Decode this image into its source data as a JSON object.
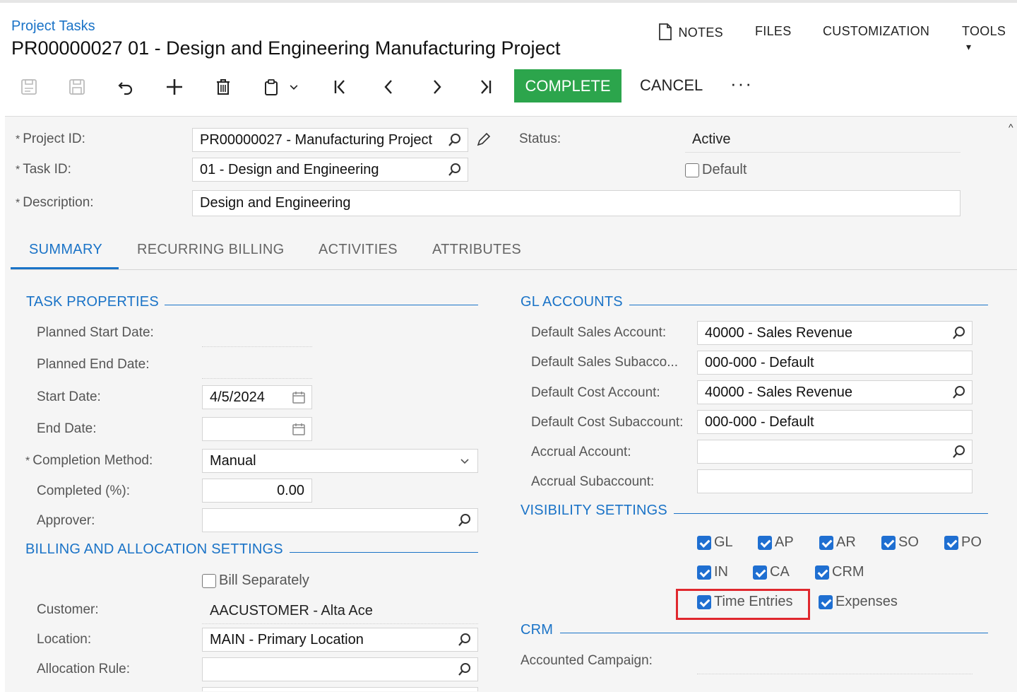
{
  "header": {
    "breadcrumb": "Project Tasks",
    "title": "PR00000027 01 - Design and Engineering Manufacturing Project",
    "menu": {
      "notes": "NOTES",
      "files": "FILES",
      "customization": "CUSTOMIZATION",
      "tools": "TOOLS"
    }
  },
  "toolbar": {
    "icons": [
      "save-close-icon",
      "save-icon",
      "undo-icon",
      "add-icon",
      "delete-icon",
      "copy-paste-icon",
      "chevron-down-icon",
      "first-record-icon",
      "previous-record-icon",
      "next-record-icon",
      "last-record-icon"
    ],
    "complete_label": "COMPLETE",
    "cancel_label": "CANCEL",
    "more_label": "···",
    "complete_color": "#2ca54c"
  },
  "form": {
    "project_id_label": "Project ID:",
    "project_id_value": "PR00000027 - Manufacturing Project",
    "task_id_label": "Task ID:",
    "task_id_value": "01 - Design and Engineering",
    "description_label": "Description:",
    "description_value": "Design and Engineering",
    "status_label": "Status:",
    "status_value": "Active",
    "default_label": "Default",
    "default_checked": false,
    "required_marker": "*"
  },
  "tabs": [
    {
      "label": "SUMMARY",
      "active": true
    },
    {
      "label": "RECURRING BILLING",
      "active": false
    },
    {
      "label": "ACTIVITIES",
      "active": false
    },
    {
      "label": "ATTRIBUTES",
      "active": false
    }
  ],
  "task_properties": {
    "heading": "TASK PROPERTIES",
    "planned_start_label": "Planned Start Date:",
    "planned_end_label": "Planned End Date:",
    "start_date_label": "Start Date:",
    "start_date_value": "4/5/2024",
    "end_date_label": "End Date:",
    "end_date_value": "",
    "completion_method_label": "Completion Method:",
    "completion_method_value": "Manual",
    "completed_pct_label": "Completed (%):",
    "completed_pct_value": "0.00",
    "approver_label": "Approver:",
    "approver_value": ""
  },
  "billing": {
    "heading": "BILLING AND ALLOCATION SETTINGS",
    "bill_separately_label": "Bill Separately",
    "bill_separately_checked": false,
    "customer_label": "Customer:",
    "customer_value": "AACUSTOMER - Alta Ace",
    "location_label": "Location:",
    "location_value": "MAIN - Primary Location",
    "allocation_rule_label": "Allocation Rule:",
    "allocation_rule_value": ""
  },
  "gl_accounts": {
    "heading": "GL ACCOUNTS",
    "sales_account_label": "Default Sales Account:",
    "sales_account_value": "40000 - Sales Revenue",
    "sales_sub_label": "Default Sales Subacco...",
    "sales_sub_value": "000-000 - Default",
    "cost_account_label": "Default Cost Account:",
    "cost_account_value": "40000 - Sales Revenue",
    "cost_sub_label": "Default Cost Subaccount:",
    "cost_sub_value": "000-000 - Default",
    "accrual_account_label": "Accrual Account:",
    "accrual_account_value": "",
    "accrual_sub_label": "Accrual Subaccount:",
    "accrual_sub_value": ""
  },
  "visibility": {
    "heading": "VISIBILITY SETTINGS",
    "items": [
      {
        "label": "GL",
        "checked": true
      },
      {
        "label": "AP",
        "checked": true
      },
      {
        "label": "AR",
        "checked": true
      },
      {
        "label": "SO",
        "checked": true
      },
      {
        "label": "PO",
        "checked": true
      },
      {
        "label": "IN",
        "checked": true
      },
      {
        "label": "CA",
        "checked": true
      },
      {
        "label": "CRM",
        "checked": true
      },
      {
        "label": "Time Entries",
        "checked": true
      },
      {
        "label": "Expenses",
        "checked": true
      }
    ],
    "highlight_color": "#e0282e"
  },
  "crm": {
    "heading": "CRM",
    "campaign_label": "Accounted Campaign:"
  },
  "colors": {
    "accent": "#1a73c7",
    "checkbox": "#1f6fd1"
  }
}
